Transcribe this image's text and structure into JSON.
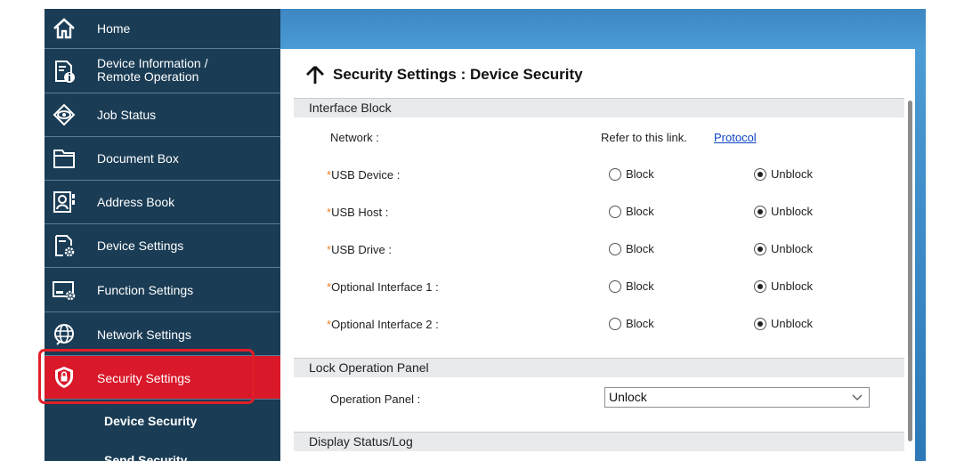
{
  "sidebar": {
    "items": [
      {
        "label": "Home",
        "icon": "home-icon"
      },
      {
        "label": "Device Information / Remote Operation",
        "line1": "Device Information /",
        "line2": "Remote Operation",
        "icon": "device-info-icon"
      },
      {
        "label": "Job Status",
        "icon": "eye-icon"
      },
      {
        "label": "Document Box",
        "icon": "folder-icon"
      },
      {
        "label": "Address Book",
        "icon": "address-book-icon"
      },
      {
        "label": "Device Settings",
        "icon": "device-settings-icon"
      },
      {
        "label": "Function Settings",
        "icon": "function-settings-icon"
      },
      {
        "label": "Network Settings",
        "icon": "globe-icon"
      },
      {
        "label": "Security Settings",
        "icon": "shield-lock-icon",
        "active": true
      }
    ],
    "sub_items": [
      "Device Security",
      "Send Security"
    ],
    "colors": {
      "background": "#1a3c55",
      "active": "#d9182a"
    }
  },
  "main": {
    "title": "Security Settings : Device Security",
    "sections": {
      "interface_block": "Interface Block",
      "lock_panel": "Lock Operation Panel",
      "display_status": "Display Status/Log"
    },
    "network": {
      "label": "Network :",
      "refer_text": "Refer to this link.",
      "link_text": "Protocol"
    },
    "required_mark": "*",
    "interface_rows": [
      {
        "label": "USB Device :",
        "value": "Unblock"
      },
      {
        "label": "USB Host :",
        "value": "Unblock"
      },
      {
        "label": "USB Drive :",
        "value": "Unblock"
      },
      {
        "label": "Optional Interface 1 :",
        "value": "Unblock"
      },
      {
        "label": "Optional Interface 2 :",
        "value": "Unblock"
      }
    ],
    "radio_labels": {
      "block": "Block",
      "unblock": "Unblock"
    },
    "operation_panel": {
      "label": "Operation Panel :",
      "selected": "Unlock"
    }
  },
  "colors": {
    "link": "#0c43c4",
    "required": "#e8832a",
    "header_band": "#3d87c3"
  }
}
